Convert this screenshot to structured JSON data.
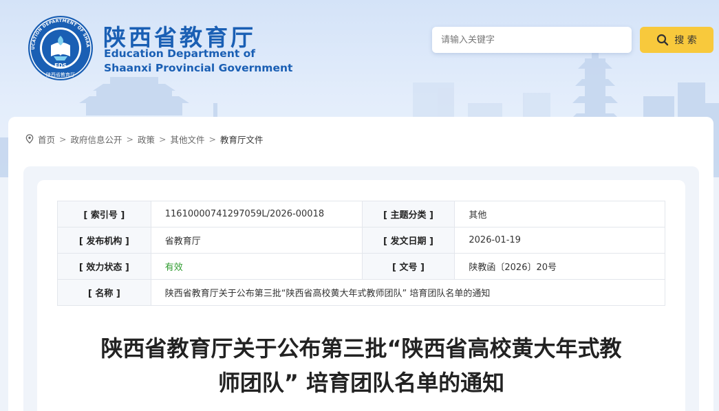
{
  "header": {
    "title_cn": "陕西省教育厅",
    "title_en_line1": "Education Department of",
    "title_en_line2": "Shaanxi Provincial Government",
    "logo": {
      "ring_text": "EDUCATION DEPARTMENT OF SHAANXI",
      "bottom_text": "陕西省教育厅",
      "center_text": "EDS"
    }
  },
  "search": {
    "placeholder": "请输入关键字",
    "button_label": "搜 索",
    "icon": "search-icon"
  },
  "breadcrumb": {
    "items": [
      "首页",
      "政府信息公开",
      "政策",
      "其他文件"
    ],
    "current": "教育厅文件",
    "separator": ">"
  },
  "meta": {
    "index_no": {
      "label": "[ 索引号 ]",
      "value": "11610000741297059L/2026-00018"
    },
    "category": {
      "label": "[ 主题分类 ]",
      "value": "其他"
    },
    "publisher": {
      "label": "[ 发布机构 ]",
      "value": "省教育厅"
    },
    "issue_date": {
      "label": "[ 发文日期 ]",
      "value": "2026-01-19"
    },
    "status": {
      "label": "[ 效力状态 ]",
      "value": "有效"
    },
    "doc_no": {
      "label": "[ 文号 ]",
      "value": "陕教函〔2026〕20号"
    },
    "name": {
      "label": "[ 名称 ]",
      "value": "陕西省教育厅关于公布第三批“陕西省高校黄大年式教师团队” 培育团队名单的通知"
    }
  },
  "document": {
    "title_line1": "陕西省教育厅关于公布第三批“陕西省高校黄大年式教",
    "title_line2": "师团队” 培育团队名单的通知"
  },
  "colors": {
    "brand_blue": "#1a5fb4",
    "search_button": "#f8c93c",
    "valid_green": "#2e9b2e"
  }
}
